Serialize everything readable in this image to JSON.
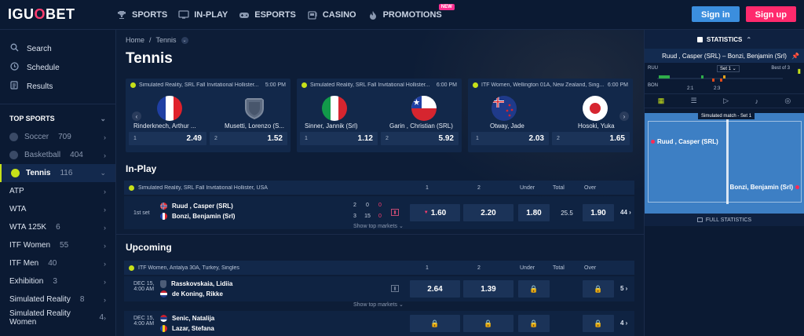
{
  "brand": {
    "prefix": "IGU",
    "accent": "O",
    "suffix": "BET"
  },
  "nav": {
    "sports": "SPORTS",
    "inplay": "IN-PLAY",
    "esports": "ESPORTS",
    "casino": "CASINO",
    "promotions": "PROMOTIONS",
    "new_badge": "NEW"
  },
  "auth": {
    "signin": "Sign in",
    "signup": "Sign up"
  },
  "sidebar": {
    "links": [
      {
        "label": "Search",
        "icon": "search-icon"
      },
      {
        "label": "Schedule",
        "icon": "clock-icon"
      },
      {
        "label": "Results",
        "icon": "document-icon"
      }
    ],
    "section": "TOP SPORTS",
    "sports": [
      {
        "label": "Soccer",
        "count": "709"
      },
      {
        "label": "Basketball",
        "count": "404"
      },
      {
        "label": "Tennis",
        "count": "116"
      }
    ],
    "categories": [
      {
        "label": "ATP",
        "count": ""
      },
      {
        "label": "WTA",
        "count": ""
      },
      {
        "label": "WTA 125K",
        "count": "6"
      },
      {
        "label": "ITF Women",
        "count": "55"
      },
      {
        "label": "ITF Men",
        "count": "40"
      },
      {
        "label": "Exhibition",
        "count": "3"
      },
      {
        "label": "Simulated Reality",
        "count": "8"
      },
      {
        "label": "Simulated Reality Women",
        "count": "4"
      }
    ]
  },
  "breadcrumb": {
    "home": "Home",
    "sep": "/",
    "current": "Tennis"
  },
  "page_title": "Tennis",
  "featured": [
    {
      "tournament": "Simulated Reality, SRL Fall Invitational Hollister...",
      "time": "5:00 PM",
      "p1": "Rinderknech, Arthur ...",
      "p2": "Musetti, Lorenzo (S...",
      "o1_label": "1",
      "o1": "2.49",
      "o2_label": "2",
      "o2": "1.52"
    },
    {
      "tournament": "Simulated Reality, SRL Fall Invitational Hollister...",
      "time": "6:00 PM",
      "p1": "Sinner, Jannik (Srl)",
      "p2": "Garin , Christian (SRL)",
      "o1_label": "1",
      "o1": "1.12",
      "o2_label": "2",
      "o2": "5.92"
    },
    {
      "tournament": "ITF Women, Wellington 01A, New Zealand, Sing...",
      "time": "6:00 PM",
      "p1": "Otway, Jade",
      "p2": "Hosoki, Yuka",
      "o1_label": "1",
      "o1": "2.03",
      "o2_label": "2",
      "o2": "1.65"
    }
  ],
  "inplay": {
    "title": "In-Play",
    "tournament": "Simulated Reality, SRL Fall Invitational Hollister, USA",
    "cols": {
      "c1": "1",
      "c2": "2",
      "under": "Under",
      "total": "Total",
      "over": "Over"
    },
    "match": {
      "status": "1st set",
      "p1": "Ruud , Casper (SRL)",
      "p2": "Bonzi, Benjamin (Srl)",
      "s1a": "2",
      "s1b": "0",
      "s1c": "0",
      "s2a": "3",
      "s2b": "15",
      "s2c": "0",
      "o1": "1.60",
      "o2": "2.20",
      "under": "1.80",
      "total": "25.5",
      "over": "1.90",
      "more": "44"
    },
    "show_top": "Show top markets"
  },
  "upcoming": {
    "title": "Upcoming",
    "tournament": "ITF Women, Antalya 30A, Turkey, Singles",
    "cols": {
      "c1": "1",
      "c2": "2",
      "under": "Under",
      "total": "Total",
      "over": "Over"
    },
    "matches": [
      {
        "date": "DEC 15,",
        "time": "4:00 AM",
        "p1": "Rasskovskaia, Lidiia",
        "p2": "de Koning, Rikke",
        "o1": "2.64",
        "o2": "1.39",
        "more": "5"
      },
      {
        "date": "DEC 15,",
        "time": "4:00 AM",
        "p1": "Senic, Natalija",
        "p2": "Lazar, Stefana",
        "o1": "",
        "o2": "",
        "more": "4"
      }
    ],
    "show_top": "Show top markets"
  },
  "stats": {
    "header": "STATISTICS",
    "match": "Ruud , Casper (SRL) – Bonzi, Benjamin (Srl)",
    "graph": {
      "t1": "RUU",
      "t2": "BON",
      "set": "Set 1",
      "best": "Best of 3",
      "g1": "2:1",
      "g2": "2:3"
    },
    "banner": "Simulated match - Set 1",
    "p1": "Ruud , Casper (SRL)",
    "p2": "Bonzi, Benjamin (Srl)",
    "full": "FULL STATISTICS"
  },
  "colors": {
    "accent_pink": "#ff2a6d",
    "accent_blue": "#3b8ede",
    "tennis": "#c6e019",
    "bg": "#0b1a33"
  }
}
